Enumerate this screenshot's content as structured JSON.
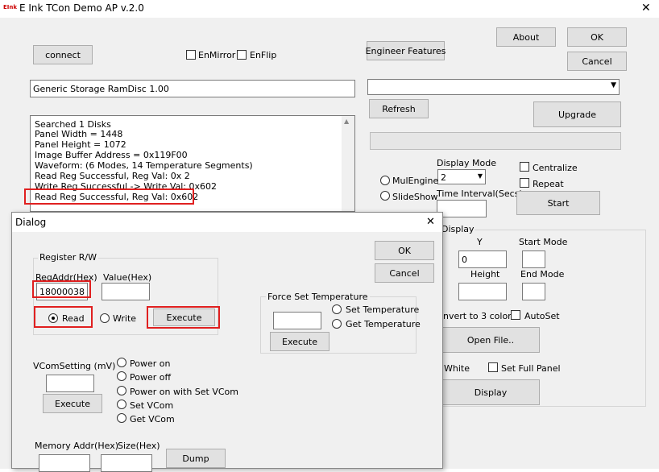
{
  "app": {
    "title": "E Ink TCon Demo AP v.2.0",
    "logo_text": "EInk"
  },
  "main": {
    "connect_label": "connect",
    "enmirror_label": "EnMirror",
    "enflip_label": "EnFlip",
    "engineer_label": "Engineer Features",
    "about_label": "About",
    "ok_label": "OK",
    "cancel_label": "Cancel",
    "storage_value": "Generic Storage RamDisc 1.00",
    "device_select_value": "",
    "refresh_label": "Refresh",
    "upgrade_label": "Upgrade",
    "log_lines": [
      "Searched 1 Disks",
      "Panel Width = 1448",
      "Panel Height = 1072",
      "Image Buffer Address = 0x119F00",
      "Waveform: (6 Modes, 14 Temperature Segments)",
      "Read Reg Successful, Reg Val: 0x 2",
      "Write Reg Successful -> Write Val: 0x602",
      "Read Reg Successful, Reg Val: 0x602"
    ],
    "display_mode_label": "Display Mode",
    "display_mode_value": "2",
    "centralize_label": "Centralize",
    "repeat_label": "Repeat",
    "mulengine_label": "MulEngine",
    "slideshow_label": "SlideShow",
    "time_interval_label": "Time Interval(Secs)",
    "start_label": "Start",
    "display_group_label": "Display",
    "y_label": "Y",
    "y_value": "0",
    "height_label": "Height",
    "start_mode_label": "Start Mode",
    "end_mode_label": "End Mode",
    "convert_label": "nvert to 3 color",
    "autoset_label": "AutoSet",
    "open_file_label": "Open File..",
    "white_label": "White",
    "set_full_panel_label": "Set Full Panel",
    "display_label": "Display"
  },
  "dialog": {
    "title": "Dialog",
    "close_glyph": "✕",
    "ok_label": "OK",
    "cancel_label": "Cancel",
    "register_group": "Register R/W",
    "regaddr_label": "RegAddr(Hex)",
    "regaddr_value": "18000038",
    "value_label": "Value(Hex)",
    "value_value": "",
    "read_label": "Read",
    "write_label": "Write",
    "execute_label": "Execute",
    "force_temp_group": "Force Set Temperature",
    "set_temp_label": "Set Temperature",
    "get_temp_label": "Get Temperature",
    "temp_execute_label": "Execute",
    "vcom_label": "VComSetting (mV)",
    "vcom_execute_label": "Execute",
    "power_on_label": "Power on",
    "power_off_label": "Power off",
    "power_on_vcom_label": "Power on with Set VCom",
    "set_vcom_label": "Set VCom",
    "get_vcom_label": "Get VCom",
    "mem_addr_label": "Memory Addr(Hex)",
    "size_label": "Size(Hex)",
    "dump_label": "Dump"
  }
}
